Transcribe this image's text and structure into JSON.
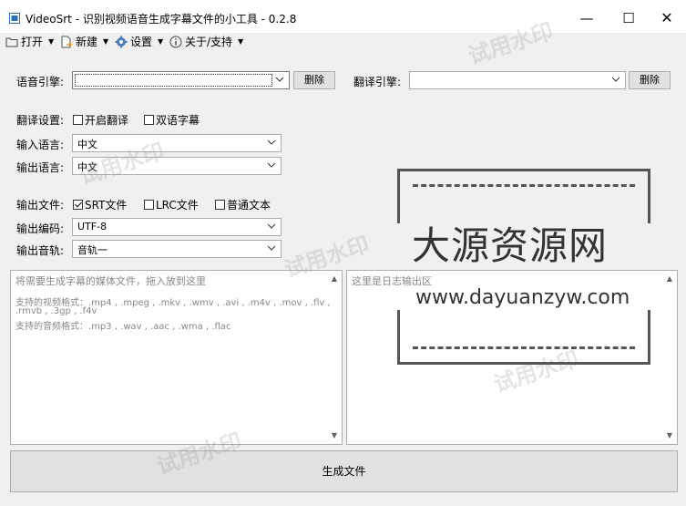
{
  "window": {
    "title": "VideoSrt - 识别视频语音生成字幕文件的小工具 - 0.2.8"
  },
  "menu": [
    {
      "label": "打开",
      "icon": "folder-icon"
    },
    {
      "label": "新建",
      "icon": "new-file-icon"
    },
    {
      "label": "设置",
      "icon": "gear-icon"
    },
    {
      "label": "关于/支持",
      "icon": "info-icon"
    }
  ],
  "speech": {
    "label": "语音引擎:",
    "value": "",
    "delete_label": "删除"
  },
  "translate_engine": {
    "label": "翻译引擎:",
    "value": "",
    "delete_label": "删除"
  },
  "translate_settings": {
    "label": "翻译设置:",
    "enable_label": "开启翻译",
    "enable_checked": false,
    "bilingual_label": "双语字幕",
    "bilingual_checked": false
  },
  "input_language": {
    "label": "输入语言:",
    "value": "中文"
  },
  "output_language": {
    "label": "输出语言:",
    "value": "中文"
  },
  "output_file": {
    "label": "输出文件:",
    "options": [
      {
        "label": "SRT文件",
        "checked": true
      },
      {
        "label": "LRC文件",
        "checked": false
      },
      {
        "label": "普通文本",
        "checked": false
      }
    ]
  },
  "output_encoding": {
    "label": "输出编码:",
    "value": "UTF-8"
  },
  "output_track": {
    "label": "输出音轨:",
    "value": "音轨一"
  },
  "media_panel": {
    "line1": "将需要生成字幕的媒体文件，拖入放到这里",
    "line2": "支持的视频格式：.mp4 , .mpeg , .mkv , .wmv , .avi , .m4v , .mov , .flv ,",
    "line3": ".rmvb , .3gp , .f4v",
    "line4": "支持的音频格式：.mp3 , .wav , .aac , .wma , .flac"
  },
  "log_panel": {
    "placeholder": "这里是日志输出区"
  },
  "generate_label": "生成文件",
  "watermark": {
    "stamp": "试用水印",
    "brand": "大源资源网",
    "url": "www.dayuanzyw.com"
  }
}
